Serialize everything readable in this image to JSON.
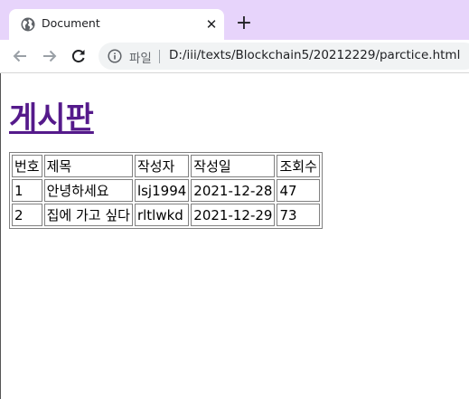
{
  "browser": {
    "tab_title": "Document",
    "close_glyph": "✕",
    "new_tab_glyph": "+",
    "scheme_label": "파일",
    "url": "D:/iii/texts/Blockchain5/20212229/parctice.html"
  },
  "page": {
    "title": "게시판",
    "title_color": "#551a8b",
    "table": {
      "headers": [
        "번호",
        "제목",
        "작성자",
        "작성일",
        "조회수"
      ],
      "rows": [
        [
          "1",
          "안녕하세요",
          "lsj1994",
          "2021-12-28",
          "47"
        ],
        [
          "2",
          "집에 가고 싶다",
          "rltlwkd",
          "2021-12-29",
          "73"
        ]
      ]
    }
  },
  "colors": {
    "tabstrip": "#e7d4fb",
    "omnibox": "#f1f3f4"
  }
}
